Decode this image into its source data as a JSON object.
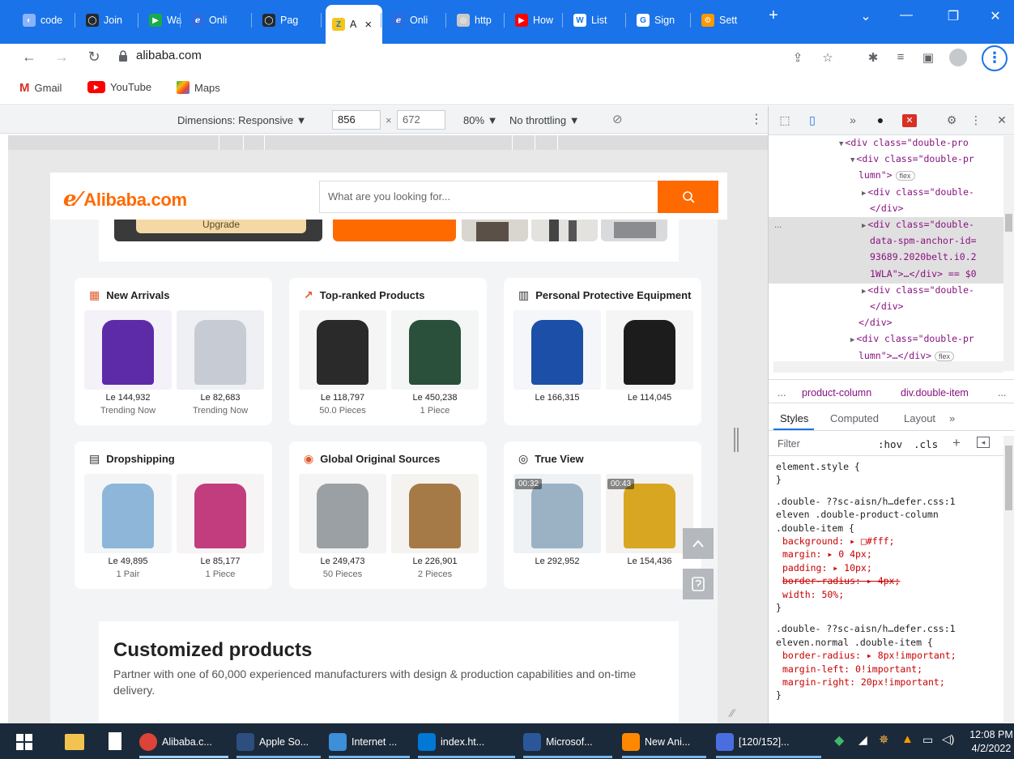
{
  "browser": {
    "tabs": [
      {
        "label": "code"
      },
      {
        "label": "Join"
      },
      {
        "label": "Wat"
      },
      {
        "label": "Onli"
      },
      {
        "label": "Pag"
      },
      {
        "label": "A",
        "active": true
      },
      {
        "label": "Onli"
      },
      {
        "label": "http"
      },
      {
        "label": "How"
      },
      {
        "label": "List"
      },
      {
        "label": "Sign"
      },
      {
        "label": "Sett"
      }
    ],
    "close_tab": "×",
    "new_tab": "+",
    "url": "alibaba.com",
    "bookmarks": [
      "Gmail",
      "YouTube",
      "Maps"
    ]
  },
  "device_toolbar": {
    "dimensions_label": "Dimensions: Responsive ▼",
    "width": "856",
    "times": "×",
    "height": "672",
    "zoom": "80% ▼",
    "throttling": "No throttling ▼"
  },
  "alibaba": {
    "logo": "Alibaba.com",
    "search_placeholder": "What are you looking for...",
    "upgrade": "Upgrade",
    "cards": [
      {
        "title": "New Arrivals",
        "items": [
          {
            "price": "Le 144,932",
            "sub": "Trending Now"
          },
          {
            "price": "Le 82,683",
            "sub": "Trending Now"
          }
        ]
      },
      {
        "title": "Top-ranked Products",
        "items": [
          {
            "price": "Le 118,797",
            "sub": "50.0 Pieces"
          },
          {
            "price": "Le 450,238",
            "sub": "1 Piece"
          }
        ]
      },
      {
        "title": "Personal Protective Equipment",
        "items": [
          {
            "price": "Le 166,315",
            "sub": ""
          },
          {
            "price": "Le 114,045",
            "sub": ""
          }
        ]
      },
      {
        "title": "Dropshipping",
        "items": [
          {
            "price": "Le 49,895",
            "sub": "1 Pair"
          },
          {
            "price": "Le 85,177",
            "sub": "1 Piece"
          }
        ]
      },
      {
        "title": "Global Original Sources",
        "items": [
          {
            "price": "Le 249,473",
            "sub": "50 Pieces"
          },
          {
            "price": "Le 226,901",
            "sub": "2 Pieces"
          }
        ]
      },
      {
        "title": "True View",
        "items": [
          {
            "price": "Le 292,952",
            "sub": "",
            "video": "00:32"
          },
          {
            "price": "Le 154,436",
            "sub": "",
            "video": "00:43"
          }
        ]
      }
    ],
    "custom_title": "Customized products",
    "custom_desc": "Partner with one of 60,000 experienced manufacturers with design & production capabilities and on-time delivery."
  },
  "devtools": {
    "elements": [
      {
        "indent": 0,
        "arrow": "▼",
        "tag": "<div class=\"double-pro",
        "tail": ""
      },
      {
        "indent": 1,
        "arrow": "▼",
        "tag": "<div class=\"double-pr",
        "tail": ""
      },
      {
        "indent": 1,
        "arrow": "",
        "tag": "lumn\">",
        "tail": "flex"
      },
      {
        "indent": 2,
        "arrow": "▶",
        "tag": "<div class=\"double-",
        "tail": ""
      },
      {
        "indent": 2,
        "arrow": "",
        "tag": "</div>",
        "tail": ""
      },
      {
        "indent": 2,
        "arrow": "▶",
        "tag": "<div class=\"double-",
        "tail": ""
      },
      {
        "indent": 2,
        "arrow": "",
        "tag": "data-spm-anchor-id=",
        "tail": ""
      },
      {
        "indent": 2,
        "arrow": "",
        "tag": "93689.2020belt.i0.2",
        "tail": ""
      },
      {
        "indent": 2,
        "arrow": "",
        "tag": "1WLA\">…</div> == $0",
        "tail": ""
      },
      {
        "indent": 2,
        "arrow": "▶",
        "tag": "<div class=\"double-",
        "tail": ""
      },
      {
        "indent": 2,
        "arrow": "",
        "tag": "</div>",
        "tail": ""
      },
      {
        "indent": 1,
        "arrow": "",
        "tag": "</div>",
        "tail": ""
      },
      {
        "indent": 1,
        "arrow": "▶",
        "tag": "<div class=\"double-pr",
        "tail": ""
      },
      {
        "indent": 1,
        "arrow": "",
        "tag": "lumn\">…</div>",
        "tail": "flex"
      }
    ],
    "dots": "...",
    "breadcrumb": [
      "...",
      "product-column",
      "div.double-item",
      "..."
    ],
    "tabs": [
      "Styles",
      "Computed",
      "Layout",
      "»"
    ],
    "filter": "Filter",
    "hov": ":hov",
    "cls": ".cls",
    "css_lines": [
      "element.style {",
      "}",
      ".double-    ??sc-aisn/h…defer.css:1",
      "eleven .double-product-column",
      ".double-item {",
      "  background: ▸ □#fff;",
      "  margin: ▸ 0 4px;",
      "  padding: ▸ 10px;",
      "  border-radius: ▸ 4px;",
      "  width: 50%;",
      "}",
      ".double-    ??sc-aisn/h…defer.css:1",
      "eleven.normal .double-item {",
      "  border-radius: ▸ 8px!important;",
      "  margin-left: 0!important;",
      "  margin-right: 20px!important;",
      "}"
    ]
  },
  "taskbar": {
    "items": [
      "Alibaba.c...",
      "Apple So...",
      "Internet ...",
      "index.ht...",
      "Microsof...",
      "New Ani...",
      "[120/152]..."
    ],
    "time": "12:08 PM",
    "date": "4/2/2022"
  }
}
